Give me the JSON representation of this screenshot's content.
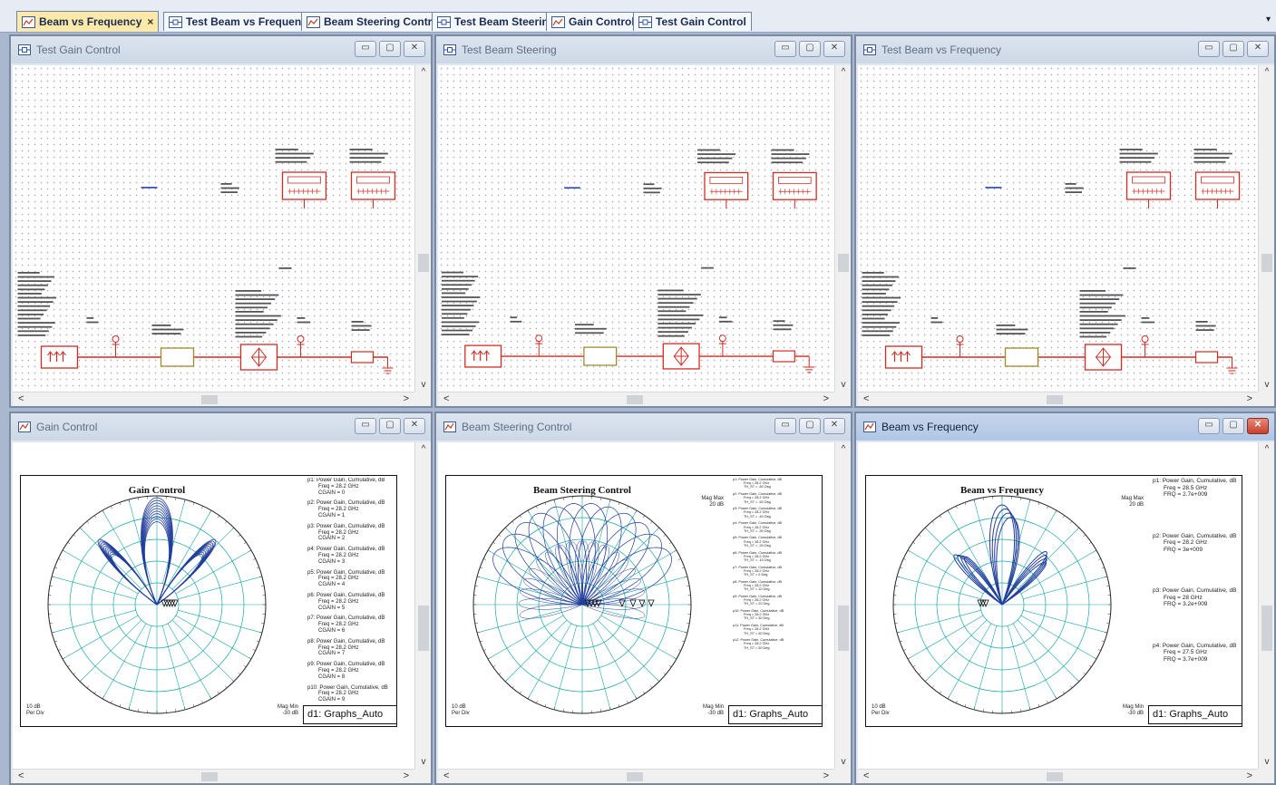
{
  "tabs": [
    {
      "label": "Beam vs Frequency",
      "icon": "graph-icon",
      "active": true,
      "closable": true
    },
    {
      "label": "Test Beam vs Frequency",
      "icon": "schematic-icon",
      "active": false
    },
    {
      "label": "Beam Steering Control",
      "icon": "graph-icon",
      "active": false
    },
    {
      "label": "Test Beam Steering",
      "icon": "schematic-icon",
      "active": false
    },
    {
      "label": "Gain Control",
      "icon": "graph-icon",
      "active": false
    },
    {
      "label": "Test Gain Control",
      "icon": "schematic-icon",
      "active": false
    }
  ],
  "tab_close_glyph": "×",
  "tab_overflow_glyph": "▾",
  "window_buttons": {
    "minimize": "▭",
    "maximize": "▢",
    "close": "✕"
  },
  "scroll_glyphs": {
    "up": "^",
    "down": "v",
    "left": "<",
    "right": ">"
  },
  "schematics": [
    {
      "title": "Test Gain Control",
      "icon": "schematic-icon"
    },
    {
      "title": "Test Beam Steering",
      "icon": "schematic-icon"
    },
    {
      "title": "Test Beam vs Frequency",
      "icon": "schematic-icon"
    }
  ],
  "graphs": [
    {
      "window_title": "Gain Control",
      "active": false,
      "graph_title": "Gain Control",
      "mag_max": [
        "",
        ""
      ],
      "mag_min": [
        "Mag Min",
        "-30 dB"
      ],
      "per_div": [
        "10 dB",
        "Per Div"
      ],
      "dataset": "d1: Graphs_Auto",
      "legend_style": "normal",
      "legend": [
        [
          "p1: Power Gain, Cumulative, dB",
          "Freq = 28.2 GHz",
          "CGAIN = 0"
        ],
        [
          "p2: Power Gain, Cumulative, dB",
          "Freq = 28.2 GHz",
          "CGAIN = 1"
        ],
        [
          "p3: Power Gain, Cumulative, dB",
          "Freq = 28.2 GHz",
          "CGAIN = 2"
        ],
        [
          "p4: Power Gain, Cumulative, dB",
          "Freq = 28.2 GHz",
          "CGAIN = 3"
        ],
        [
          "p5: Power Gain, Cumulative, dB",
          "Freq = 28.2 GHz",
          "CGAIN = 4"
        ],
        [
          "p6: Power Gain, Cumulative, dB",
          "Freq = 28.2 GHz",
          "CGAIN = 5"
        ],
        [
          "p7: Power Gain, Cumulative, dB",
          "Freq = 28.2 GHz",
          "CGAIN = 6"
        ],
        [
          "p8: Power Gain, Cumulative, dB",
          "Freq = 28.2 GHz",
          "CGAIN = 7"
        ],
        [
          "p9: Power Gain, Cumulative, dB",
          "Freq = 28.2 GHz",
          "CGAIN = 8"
        ],
        [
          "p10: Power Gain, Cumulative, dB",
          "Freq = 28.2 GHz",
          "CGAIN = 9"
        ]
      ]
    },
    {
      "window_title": "Beam Steering Control",
      "active": false,
      "graph_title": "Beam Steering Control",
      "mag_max": [
        "Mag Max",
        "20 dB"
      ],
      "mag_min": [
        "Mag Min",
        "-30 dB"
      ],
      "per_div": [
        "10 dB",
        "Per Div"
      ],
      "dataset": "d1: Graphs_Auto",
      "legend_style": "dense",
      "legend": [
        [
          "p1: Power Gain, Cumulative, dB",
          "Freq = 28.2 GHz",
          "TH_ST = -60 Deg"
        ],
        [
          "p2: Power Gain, Cumulative, dB",
          "Freq = 28.2 GHz",
          "TH_ST = -50 Deg"
        ],
        [
          "p3: Power Gain, Cumulative, dB",
          "Freq = 28.2 GHz",
          "TH_ST = -40 Deg"
        ],
        [
          "p4: Power Gain, Cumulative, dB",
          "Freq = 28.2 GHz",
          "TH_ST = -30 Deg"
        ],
        [
          "p5: Power Gain, Cumulative, dB",
          "Freq = 28.2 GHz",
          "TH_ST = -20 Deg"
        ],
        [
          "p6: Power Gain, Cumulative, dB",
          "Freq = 28.2 GHz",
          "TH_ST = -10 Deg"
        ],
        [
          "p7: Power Gain, Cumulative, dB",
          "Freq = 28.2 GHz",
          "TH_ST = 0 Deg"
        ],
        [
          "p8: Power Gain, Cumulative, dB",
          "Freq = 28.2 GHz",
          "TH_ST = 10 Deg"
        ],
        [
          "p9: Power Gain, Cumulative, dB",
          "Freq = 28.2 GHz",
          "TH_ST = 20 Deg"
        ],
        [
          "p10: Power Gain, Cumulative, dB",
          "Freq = 28.2 GHz",
          "TH_ST = 30 Deg"
        ],
        [
          "p11: Power Gain, Cumulative, dB",
          "Freq = 28.2 GHz",
          "TH_ST = 40 Deg"
        ],
        [
          "p12: Power Gain, Cumulative, dB",
          "Freq = 28.2 GHz",
          "TH_ST = 50 Deg"
        ]
      ]
    },
    {
      "window_title": "Beam vs Frequency",
      "active": true,
      "graph_title": "Beam vs Frequency",
      "mag_max": [
        "Mag Max",
        "20 dB"
      ],
      "mag_min": [
        "Mag Min",
        "-30 dB"
      ],
      "per_div": [
        "10 dB",
        "Per Div"
      ],
      "dataset": "d1: Graphs_Auto",
      "legend_style": "sparse",
      "legend": [
        [
          "p1: Power Gain, Cumulative, dB",
          "Freq = 28.5 GHz",
          "FRQ = 2.7e+009"
        ],
        [
          "p2: Power Gain, Cumulative, dB",
          "Freq = 28.2 GHz",
          "FRQ = 3e+009"
        ],
        [
          "p3: Power Gain, Cumulative, dB",
          "Freq = 28 GHz",
          "FRQ = 3.2e+009"
        ],
        [
          "p4: Power Gain, Cumulative, dB",
          "Freq = 27.5 GHz",
          "FRQ = 3.7e+009"
        ]
      ]
    }
  ],
  "colors": {
    "trace": "#233f9c",
    "grid": "#1aa6a6",
    "schematic": "#d22b22",
    "subckt": "#a08a2c"
  }
}
